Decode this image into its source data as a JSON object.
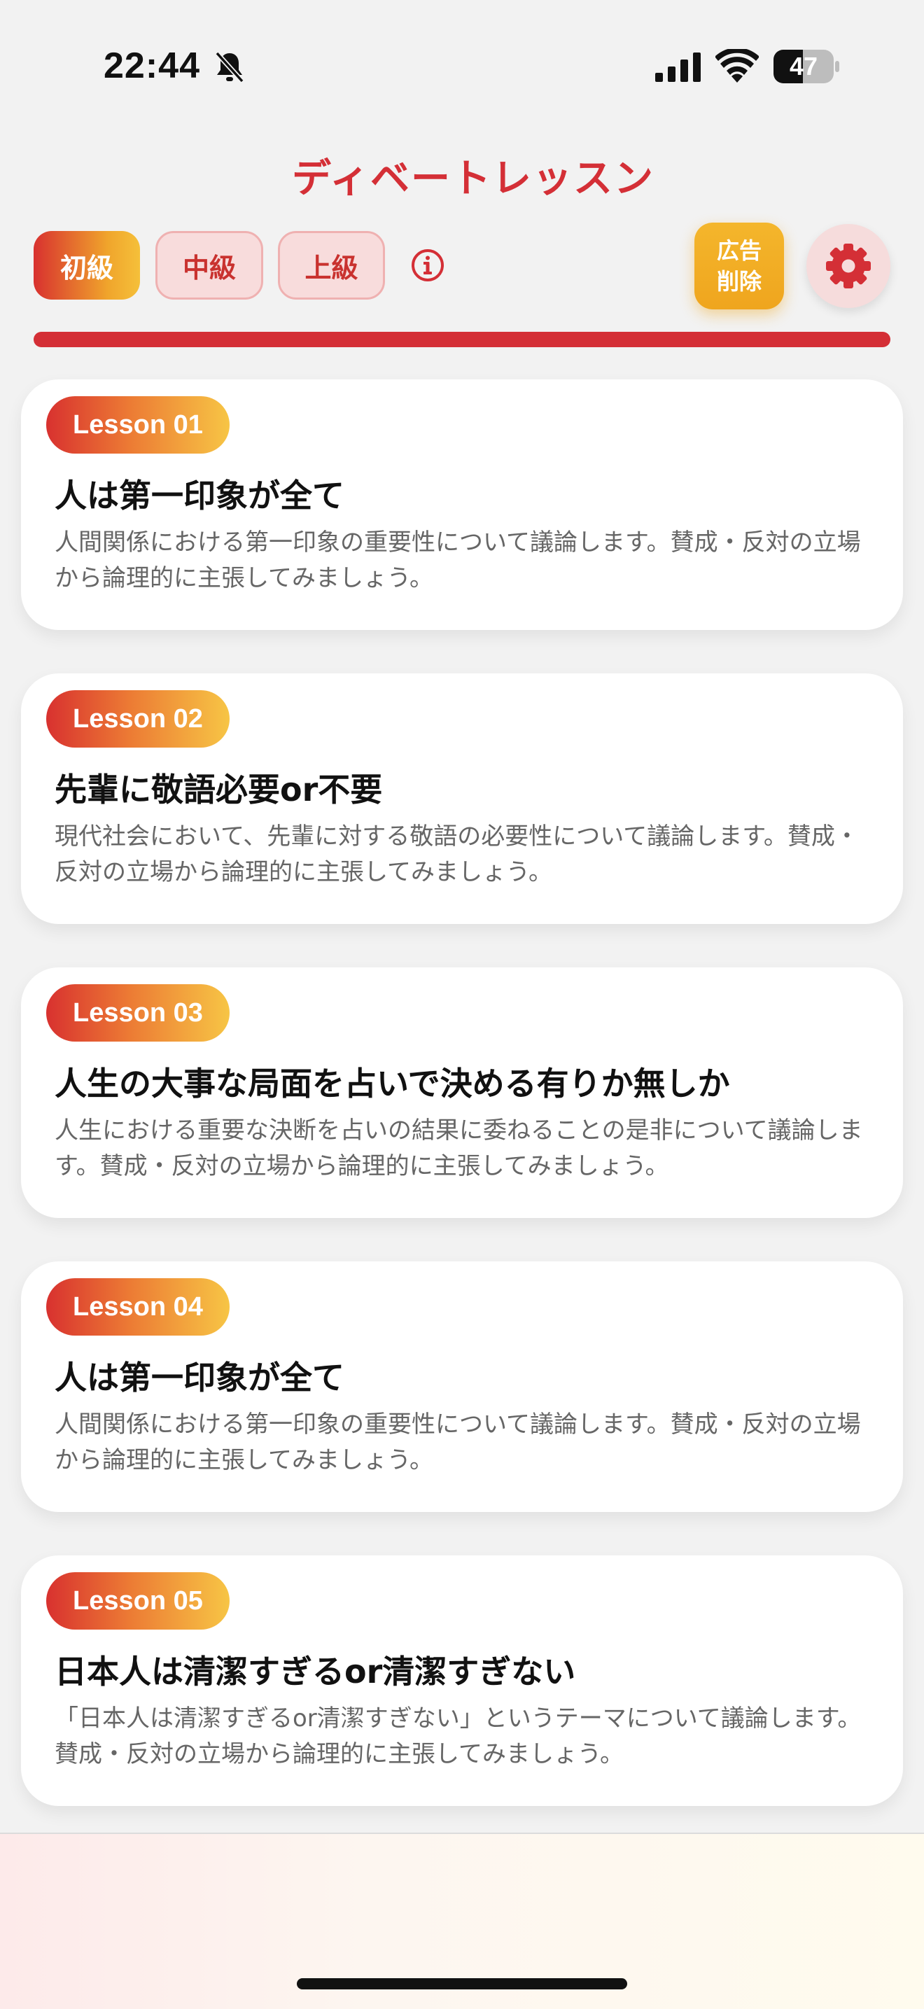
{
  "status_bar": {
    "time": "22:44",
    "battery": "47"
  },
  "header": {
    "title": "ディベートレッスン"
  },
  "level_tabs": [
    {
      "label": "初級",
      "selected": true
    },
    {
      "label": "中級",
      "selected": false
    },
    {
      "label": "上級",
      "selected": false
    }
  ],
  "remove_ads": {
    "line1": "広告",
    "line2": "削除"
  },
  "colors": {
    "accent_red": "#d42f36",
    "accent_orange": "#f0a52c",
    "accent_yellow": "#f5c03a"
  },
  "lessons": [
    {
      "badge": "Lesson 01",
      "title": "人は第一印象が全て",
      "description": "人間関係における第一印象の重要性について議論します。賛成・反対の立場から論理的に主張してみましょう。"
    },
    {
      "badge": "Lesson 02",
      "title": "先輩に敬語必要or不要",
      "description": "現代社会において、先輩に対する敬語の必要性について議論します。賛成・反対の立場から論理的に主張してみましょう。"
    },
    {
      "badge": "Lesson 03",
      "title": "人生の大事な局面を占いで決める有りか無しか",
      "description": "人生における重要な決断を占いの結果に委ねることの是非について議論します。賛成・反対の立場から論理的に主張してみましょう。"
    },
    {
      "badge": "Lesson 04",
      "title": "人は第一印象が全て",
      "description": "人間関係における第一印象の重要性について議論します。賛成・反対の立場から論理的に主張してみましょう。"
    },
    {
      "badge": "Lesson 05",
      "title": "日本人は清潔すぎるor清潔すぎない",
      "description": "「日本人は清潔すぎるor清潔すぎない」というテーマについて議論します。賛成・反対の立場から論理的に主張してみましょう。"
    }
  ]
}
